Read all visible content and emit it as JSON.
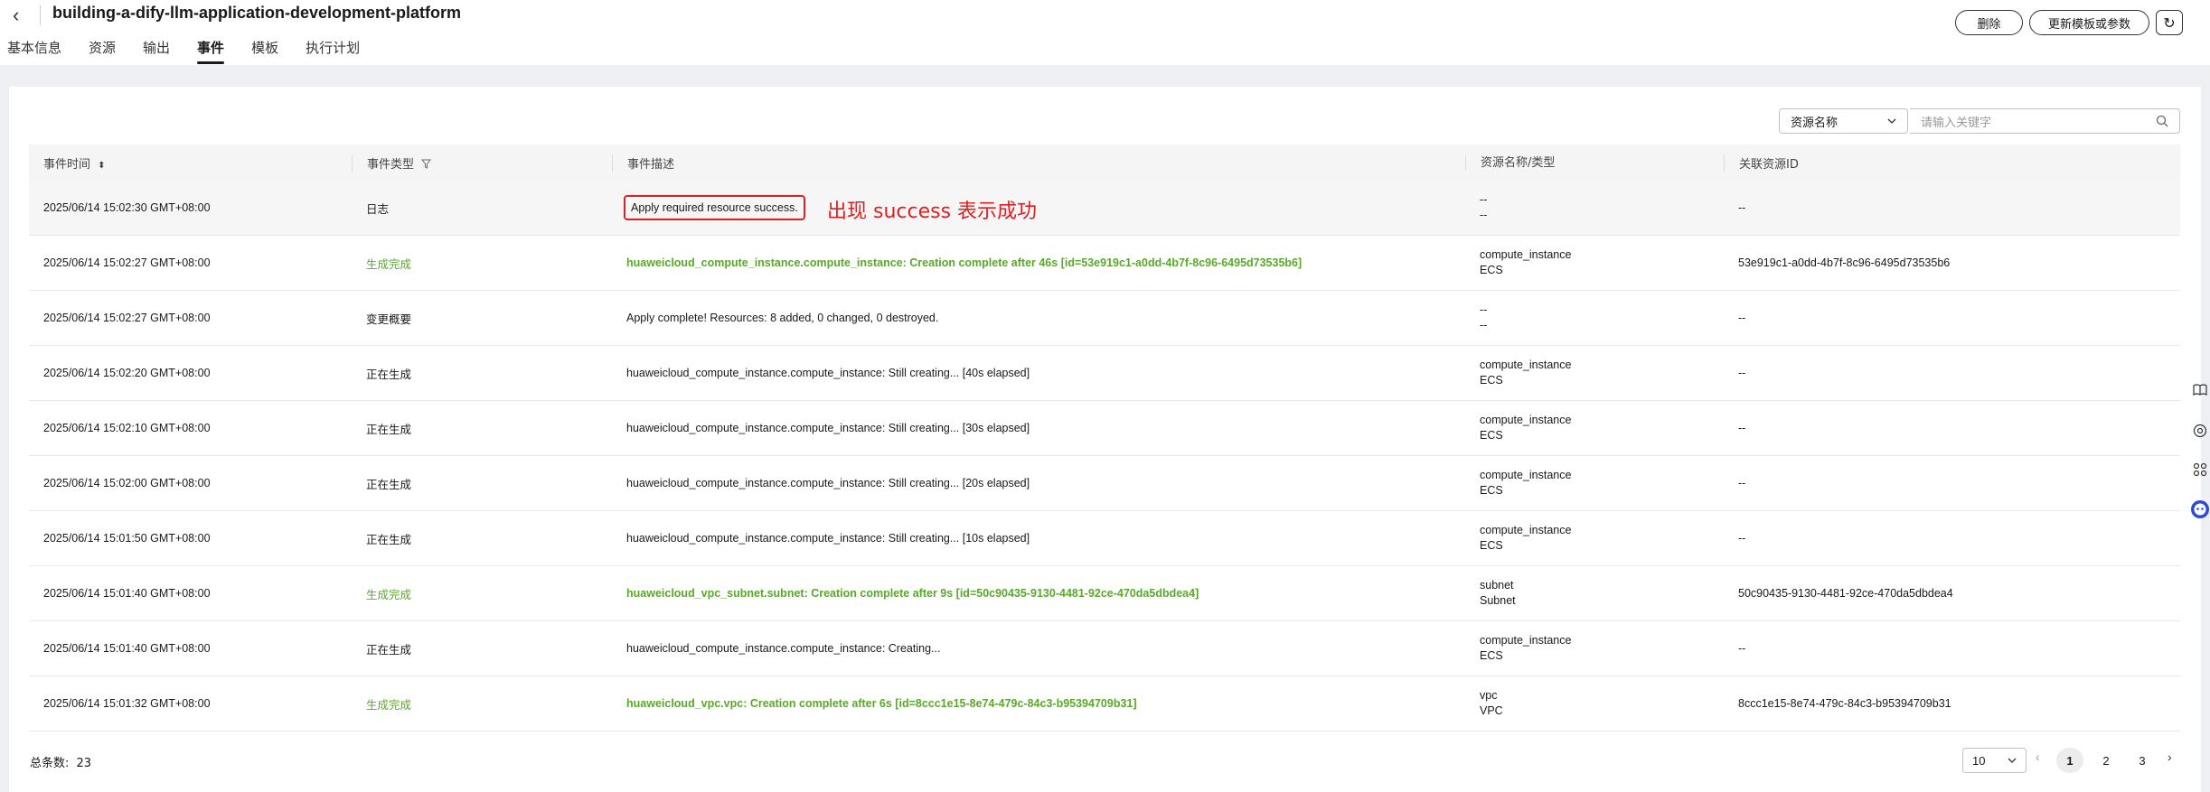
{
  "header": {
    "title": "building-a-dify-llm-application-development-platform",
    "back_icon": "‹",
    "delete_label": "删除",
    "update_label": "更新模板或参数",
    "refresh_icon": "↻"
  },
  "tabs": [
    "基本信息",
    "资源",
    "输出",
    "事件",
    "模板",
    "执行计划"
  ],
  "active_tab": "事件",
  "filter": {
    "select_value": "资源名称",
    "search_placeholder": "请输入关键字"
  },
  "table": {
    "columns": [
      "事件时间",
      "事件类型",
      "事件描述",
      "资源名称/类型",
      "关联资源ID"
    ],
    "rows": [
      {
        "time": "2025/06/14 15:02:30 GMT+08:00",
        "type": "日志",
        "desc": "Apply required resource success.",
        "name": "--",
        "rtype": "--",
        "id": "--"
      },
      {
        "time": "2025/06/14 15:02:27 GMT+08:00",
        "type": "生成完成",
        "desc": "huaweicloud_compute_instance.compute_instance: Creation complete after 46s [id=53e919c1-a0dd-4b7f-8c96-6495d73535b6]",
        "name": "compute_instance",
        "rtype": "ECS",
        "id": "53e919c1-a0dd-4b7f-8c96-6495d73535b6"
      },
      {
        "time": "2025/06/14 15:02:27 GMT+08:00",
        "type": "变更概要",
        "desc": "Apply complete! Resources: 8 added, 0 changed, 0 destroyed.",
        "name": "--",
        "rtype": "--",
        "id": "--"
      },
      {
        "time": "2025/06/14 15:02:20 GMT+08:00",
        "type": "正在生成",
        "desc": "huaweicloud_compute_instance.compute_instance: Still creating... [40s elapsed]",
        "name": "compute_instance",
        "rtype": "ECS",
        "id": "--"
      },
      {
        "time": "2025/06/14 15:02:10 GMT+08:00",
        "type": "正在生成",
        "desc": "huaweicloud_compute_instance.compute_instance: Still creating... [30s elapsed]",
        "name": "compute_instance",
        "rtype": "ECS",
        "id": "--"
      },
      {
        "time": "2025/06/14 15:02:00 GMT+08:00",
        "type": "正在生成",
        "desc": "huaweicloud_compute_instance.compute_instance: Still creating... [20s elapsed]",
        "name": "compute_instance",
        "rtype": "ECS",
        "id": "--"
      },
      {
        "time": "2025/06/14 15:01:50 GMT+08:00",
        "type": "正在生成",
        "desc": "huaweicloud_compute_instance.compute_instance: Still creating... [10s elapsed]",
        "name": "compute_instance",
        "rtype": "ECS",
        "id": "--"
      },
      {
        "time": "2025/06/14 15:01:40 GMT+08:00",
        "type": "生成完成",
        "desc": "huaweicloud_vpc_subnet.subnet: Creation complete after 9s [id=50c90435-9130-4481-92ce-470da5dbdea4]",
        "name": "subnet",
        "rtype": "Subnet",
        "id": "50c90435-9130-4481-92ce-470da5dbdea4"
      },
      {
        "time": "2025/06/14 15:01:40 GMT+08:00",
        "type": "正在生成",
        "desc": "huaweicloud_compute_instance.compute_instance: Creating...",
        "name": "compute_instance",
        "rtype": "ECS",
        "id": "--"
      },
      {
        "time": "2025/06/14 15:01:32 GMT+08:00",
        "type": "生成完成",
        "desc": "huaweicloud_vpc.vpc: Creation complete after 6s [id=8ccc1e15-8e74-479c-84c3-b95394709b31]",
        "name": "vpc",
        "rtype": "VPC",
        "id": "8ccc1e15-8e74-479c-84c3-b95394709b31"
      }
    ]
  },
  "annotation": "出现 success 表示成功",
  "footer": {
    "total_label": "总条数:",
    "total_value": "23",
    "page_size": "10",
    "pages": [
      "1",
      "2",
      "3"
    ],
    "current_page": "1"
  },
  "colors": {
    "success_green": "#5aa82b",
    "annotation_red": "#e02020"
  }
}
